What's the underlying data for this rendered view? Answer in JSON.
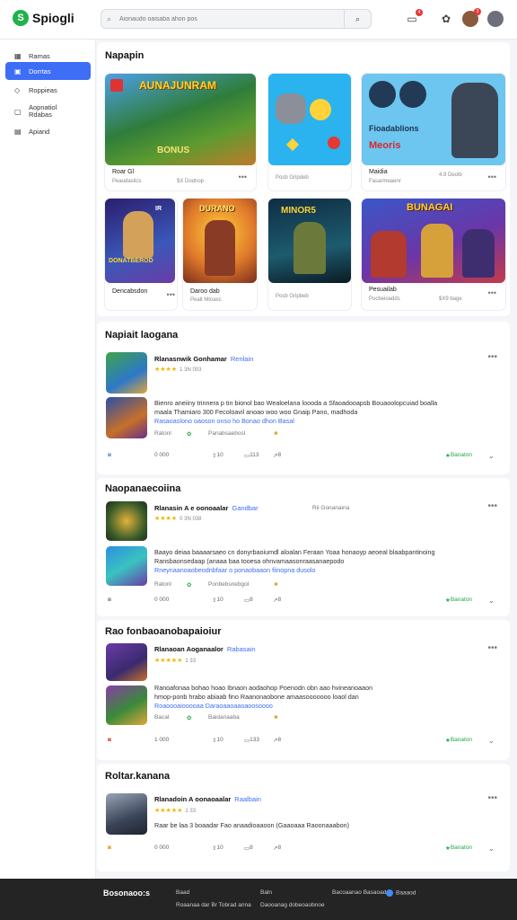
{
  "header": {
    "logo": "Spiogli",
    "search_placeholder": "Aionaudo oaisaba ahon pos",
    "notif_count": "4",
    "avatar_badge": "3"
  },
  "sidebar": {
    "items": [
      {
        "label": "Ramas",
        "icon": "grid-icon"
      },
      {
        "label": "Dorrtas",
        "icon": "store-icon"
      },
      {
        "label": "Roppieas",
        "icon": "tag-icon"
      },
      {
        "label": "Aopnatiol Rdabas",
        "icon": "clipboard-icon"
      },
      {
        "label": "Apiand",
        "icon": "doc-icon"
      }
    ]
  },
  "featured": {
    "title": "Napapin",
    "tiles": [
      {
        "name": "Roar Gl",
        "meta": "Peaudaslics",
        "meta2": "$X  Dodnop",
        "more": "•••",
        "art": "AUNAJUNRAM",
        "art2": "BONUS"
      },
      {
        "name": "",
        "meta": "Posb Gripdeb",
        "meta2": "",
        "more": "•••",
        "art": "",
        "art2": ""
      },
      {
        "name": "Maidia",
        "meta": "Fasarmeaenr",
        "meta2": "4.9  Deolb",
        "more": "•••",
        "art": "Fioadablions",
        "art2": "Meoris"
      },
      {
        "name": "Dencabsdon",
        "meta": "",
        "meta2": "",
        "more": "•••",
        "art": "DONATBEROD",
        "art2": "IR"
      },
      {
        "name": "Daroo dab",
        "meta": "Pealt Mtoasc",
        "meta2": "",
        "more": "",
        "art": "DURANO",
        "art2": ""
      },
      {
        "name": "",
        "meta": "Posb Gripbeb",
        "meta2": "",
        "more": "",
        "art": "MINOR5",
        "art2": ""
      },
      {
        "name": "Pesuailab",
        "meta": "Pocbeioadds",
        "meta2": "$X9  bage",
        "more": "•••",
        "art": "BUNAGAI",
        "art2": ""
      }
    ]
  },
  "posts": [
    {
      "section": "Napiait laogana",
      "title": "Rlanasnwik Gonhamar",
      "tag": "Renlain",
      "stars": "★★★★",
      "count": "1 3N 003",
      "extra": "",
      "text1": "Bienro aneiiny trinnera p tin bionol bao Wealoelana loooda a Sfaoadooapsb Bouaoolopcuiad boalla",
      "text2": "maala Thamiaro 300 Fecoloavil anoao woo woo Gnaip Pano, madhoda",
      "link": "Rasaoaslono oaoson onso ho Bonao dhon Basal",
      "meta": "Ratonl",
      "meta2": "Panabsaebosl",
      "extra2": "",
      "actions": {
        "rate": "0 000",
        "likes": "10",
        "comments": "113",
        "shares": "8",
        "follow": "Banaton"
      }
    },
    {
      "section": "Naopanaecoiina",
      "title": "Rlanasin A e oonoaalar",
      "tag": "Gandbar",
      "stars": "★★★★",
      "count": "0 3N 038",
      "extra": "Rii Gonanaina",
      "text1": "Baayo deiaa baaaarsaeo cn donyrbaoiumdl aloalan Feraan Yoaa honaoyp aeoeal blaabpantinoing",
      "text2": "Ransbaonsedaap (anaaa baa tooesa ohnvamaasonraasanaepodo",
      "link": "Rneynaanoaobeodnbfaar o ponaobaaon fiinopna dusolo",
      "meta": "Ratonl",
      "meta2": "Ponbebsnebgol",
      "extra2": "",
      "actions": {
        "rate": "0 000",
        "likes": "10",
        "comments": "8",
        "shares": "8",
        "follow": "Banaton"
      }
    },
    {
      "section": "Rao fonbaoanobapaioiur",
      "title": "Rlanaoan Aoganaalor",
      "tag": "Rabasain",
      "stars": "★★★★★",
      "count": "1 33",
      "extra": "",
      "text1": "Ranoafonaa bohao hoao Ibnaon aodaohop Poenodn obn aao hvineanoaaon",
      "text2": "hmop-ponb hrabo abiaab fino Raanonaobone amaasooooooo loaol dan",
      "link": "Roaoooaiooooaa Daraoaaoaaoaoosoooo",
      "meta": "Bacal",
      "meta2": "Baidanaaba",
      "extra2": "",
      "actions": {
        "rate": "1 000",
        "likes": "10",
        "comments": "133",
        "shares": "8",
        "follow": "Banaton"
      }
    },
    {
      "section": "Roltar.kanana",
      "title": "Rlanadoin A oonaoaalar",
      "tag": "Raalbain",
      "stars": "★★★★★",
      "count": "1 33",
      "extra": "",
      "text1": "Raar be laa  3  boaadar Fao anaadioaaoon  (Gaaoaaa Raoonaaabon)",
      "text2": "",
      "link": "",
      "meta": "",
      "meta2": "",
      "extra2": "",
      "actions": {
        "rate": "0 000",
        "likes": "10",
        "comments": "8",
        "shares": "8",
        "follow": "Banaton"
      }
    }
  ],
  "footer": {
    "brand": "Bosonaoo:s",
    "col1": [
      "Baad",
      "Roaanaa dar Br Tobrad anna"
    ],
    "col2": [
      "Baln",
      "Daooanag dobeoaobnoe"
    ],
    "col3": [
      "Bacoaanao Basaoado",
      "Baaaod"
    ]
  }
}
